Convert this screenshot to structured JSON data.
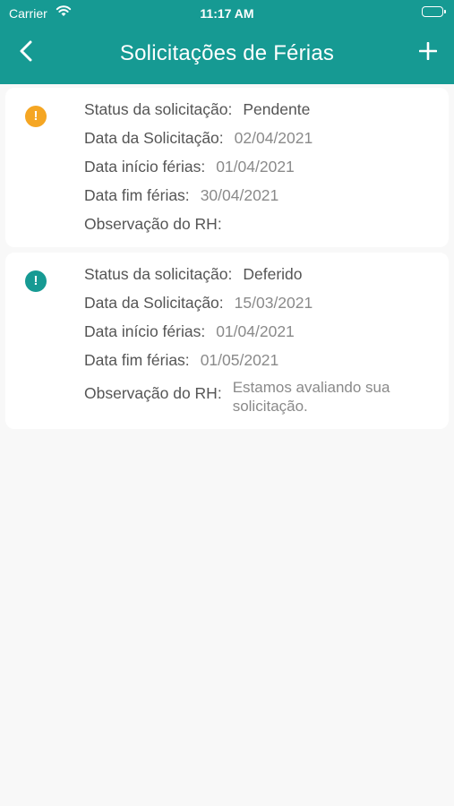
{
  "status_bar": {
    "carrier": "Carrier",
    "time": "11:17 AM"
  },
  "nav": {
    "title": "Solicitações de Férias",
    "back_icon": "chevron-left-icon",
    "add_icon": "plus-icon"
  },
  "labels": {
    "status": "Status da solicitação:",
    "request_date": "Data da Solicitação:",
    "start_date": "Data início férias:",
    "end_date": "Data fim férias:",
    "hr_note": "Observação do RH:"
  },
  "requests": [
    {
      "icon": "alert-icon",
      "icon_glyph": "!",
      "icon_color": "#f5a623",
      "status": "Pendente",
      "request_date": "02/04/2021",
      "start_date": "01/04/2021",
      "end_date": "30/04/2021",
      "hr_note": ""
    },
    {
      "icon": "alert-icon",
      "icon_glyph": "!",
      "icon_color": "#169a93",
      "status": "Deferido",
      "request_date": "15/03/2021",
      "start_date": "01/04/2021",
      "end_date": "01/05/2021",
      "hr_note": "Estamos avaliando sua solicitação."
    }
  ],
  "colors": {
    "header": "#169a93",
    "pending": "#f5a623",
    "approved": "#169a93",
    "background": "#f8f8f8"
  }
}
